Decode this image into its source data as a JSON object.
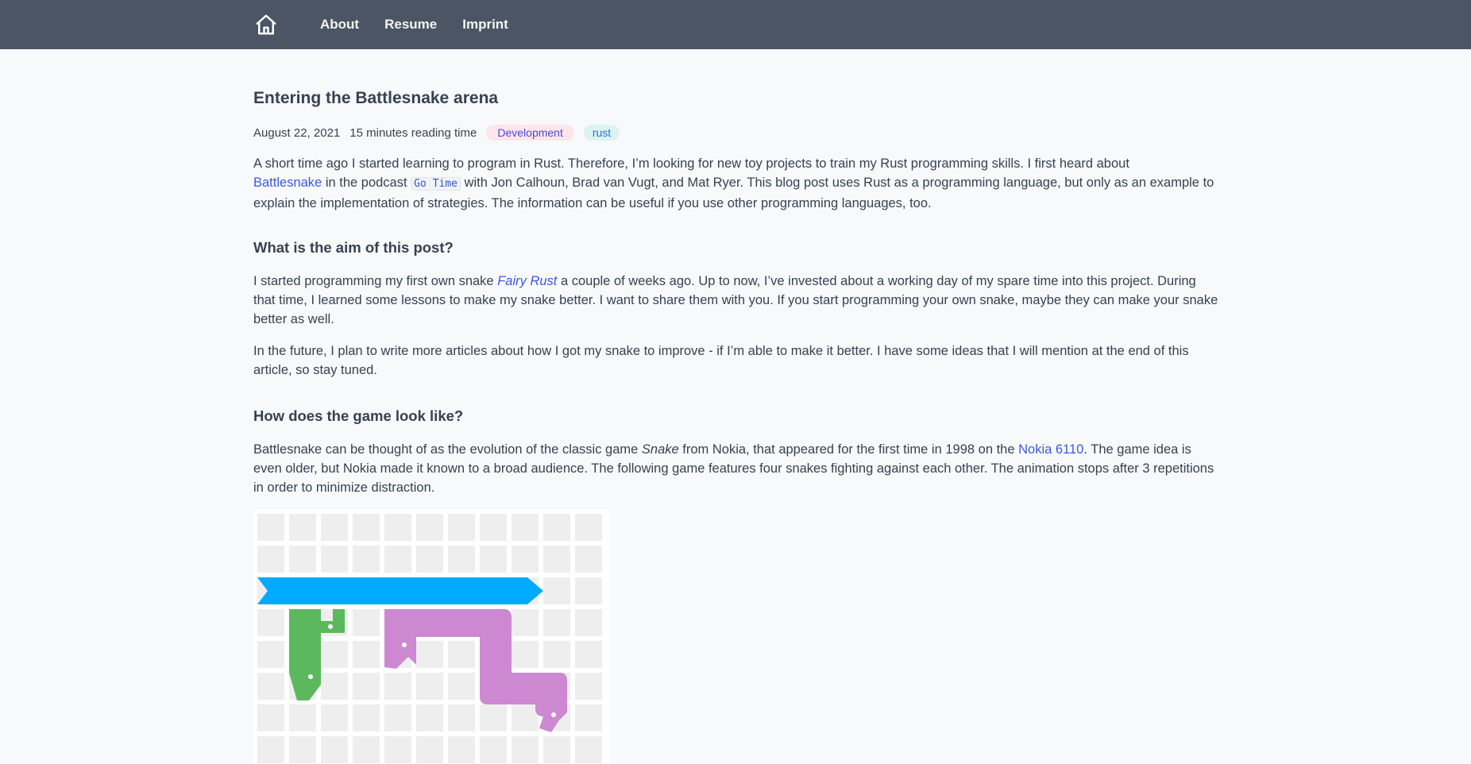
{
  "nav": {
    "home_icon": "home-icon",
    "items": [
      "About",
      "Resume",
      "Imprint"
    ]
  },
  "post": {
    "title": "Entering the Battlesnake arena",
    "date": "August 22, 2021",
    "reading_time": "15 minutes reading time",
    "tags": [
      "Development",
      "rust"
    ],
    "intro": {
      "t1": "A short time ago I started learning to program in Rust. Therefore, I’m looking for new toy projects to train my Rust programming skills. I first heard about",
      "link_battlesnake": "Battlesnake",
      "t2": " in the podcast ",
      "code_go_time": "Go Time",
      "t3": " with Jon Calhoun, Brad van Vugt, and Mat Ryer. This blog post uses Rust as a programming language, but only as an example to explain the implementation of strategies. The information can be useful if you use other programming languages, too."
    },
    "h_aim": "What is the aim of this post?",
    "aim_p1": {
      "t1": "I started programming my first own snake ",
      "link_fairy_rust": "Fairy Rust",
      "t2": " a couple of weeks ago. Up to now, I’ve invested about a working day of my spare time into this project. During that time, I learned some lessons to make my snake better. I want to share them with you. If you start programming your own snake, maybe they can make your snake better as well."
    },
    "aim_p2": "In the future, I plan to write more articles about how I got my snake to improve - if I’m able to make it better. I have some ideas that I will mention at the end of this article, so stay tuned.",
    "h_game": "How does the game look like?",
    "game_p": {
      "t1": "Battlesnake can be thought of as the evolution of the classic game ",
      "em_snake": "Snake",
      "t2": " from Nokia, that appeared for the first time in 1998 on the ",
      "link_nokia": "Nokia 6110",
      "t3": ". The game idea is even older, but Nokia made it known to a broad audience. The following game features four snakes fighting against each other. The animation stops after 3 repetitions in order to minimize distraction."
    },
    "game_colors": {
      "cell": "#eeeeee",
      "blue_snake": "#00aaff",
      "green_snake": "#5cb85c",
      "purple_snake": "#cc88d0"
    }
  }
}
